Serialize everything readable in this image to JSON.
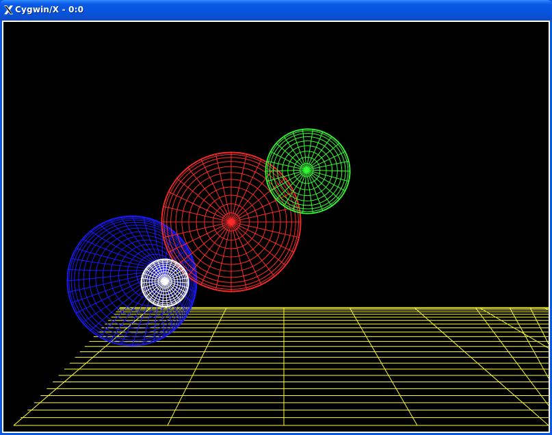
{
  "window": {
    "title": "Cygwin/X - 0:0",
    "icon": "x-logo-icon"
  },
  "scene": {
    "background": "#000000",
    "floor_color": "#ffff33",
    "spheres": [
      {
        "name": "red-sphere",
        "color": "#ff2a2a"
      },
      {
        "name": "green-sphere",
        "color": "#33ff33"
      },
      {
        "name": "blue-sphere",
        "color": "#1a1aff"
      },
      {
        "name": "white-sphere",
        "color": "#ffffff"
      }
    ]
  }
}
